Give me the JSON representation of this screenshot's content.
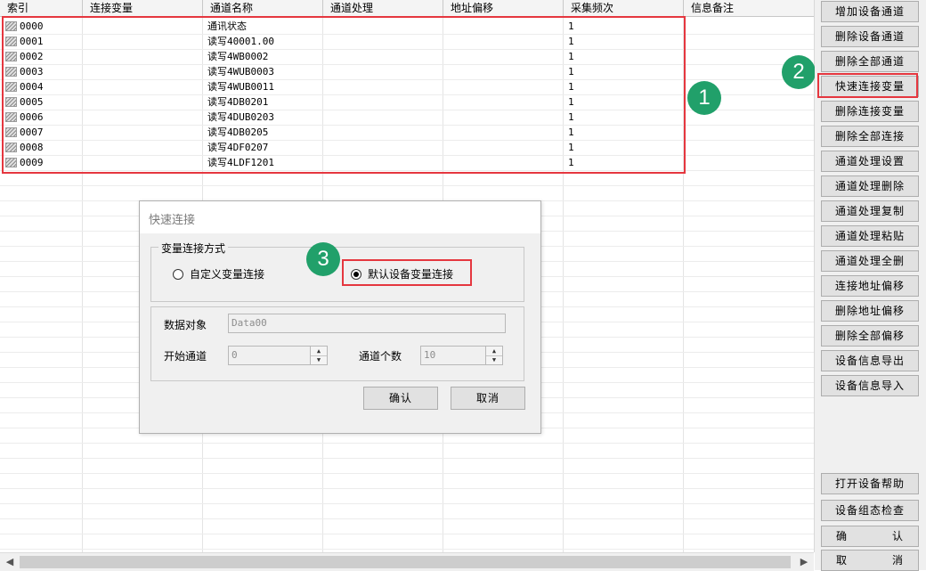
{
  "table": {
    "headers": [
      "索引",
      "连接变量",
      "通道名称",
      "通道处理",
      "地址偏移",
      "采集频次",
      "信息备注"
    ],
    "rows": [
      {
        "index": "0000",
        "name": "通讯状态",
        "freq": "1"
      },
      {
        "index": "0001",
        "name": "读写40001.00",
        "freq": "1"
      },
      {
        "index": "0002",
        "name": "读写4WB0002",
        "freq": "1"
      },
      {
        "index": "0003",
        "name": "读写4WUB0003",
        "freq": "1"
      },
      {
        "index": "0004",
        "name": "读写4WUB0011",
        "freq": "1"
      },
      {
        "index": "0005",
        "name": "读写4DB0201",
        "freq": "1"
      },
      {
        "index": "0006",
        "name": "读写4DUB0203",
        "freq": "1"
      },
      {
        "index": "0007",
        "name": "读写4DB0205",
        "freq": "1"
      },
      {
        "index": "0008",
        "name": "读写4DF0207",
        "freq": "1"
      },
      {
        "index": "0009",
        "name": "读写4LDF1201",
        "freq": "1"
      }
    ]
  },
  "badges": {
    "b1": "1",
    "b2": "2",
    "b3": "3"
  },
  "right_buttons": [
    "增加设备通道",
    "删除设备通道",
    "删除全部通道",
    "快速连接变量",
    "删除连接变量",
    "删除全部连接",
    "通道处理设置",
    "通道处理删除",
    "通道处理复制",
    "通道处理粘贴",
    "通道处理全删",
    "连接地址偏移",
    "删除地址偏移",
    "删除全部偏移",
    "设备信息导出",
    "设备信息导入"
  ],
  "bottom_buttons": {
    "help": "打开设备帮助",
    "check": "设备组态检查",
    "confirm_l": "确",
    "confirm_r": "认",
    "cancel_l": "取",
    "cancel_r": "消"
  },
  "dialog": {
    "title": "快速连接",
    "group_label": "变量连接方式",
    "radio_custom": "自定义变量连接",
    "radio_default": "默认设备变量连接",
    "data_object_label": "数据对象",
    "data_object_value": "Data00",
    "start_channel_label": "开始通道",
    "start_channel_value": "0",
    "channel_count_label": "通道个数",
    "channel_count_value": "10",
    "ok": "确认",
    "cancel": "取消"
  },
  "colors": {
    "highlight": "#e5373f",
    "badge": "#21a06a"
  }
}
